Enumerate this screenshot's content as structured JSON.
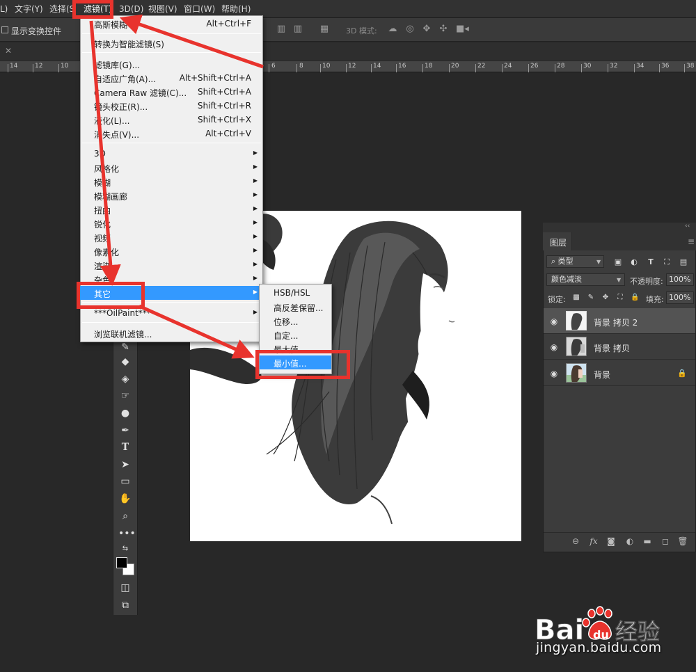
{
  "menubar": {
    "items": [
      "L)",
      "文字(Y)",
      "选择(S",
      "滤镜(T)",
      "3D(D)",
      "视图(V)",
      "窗口(W)",
      "帮助(H)"
    ]
  },
  "options": {
    "show_transform_label": "显示变换控件",
    "mode_3d_label": "3D 模式:"
  },
  "ruler": {
    "labels": [
      "14",
      "12",
      "10",
      "6",
      "8",
      "10",
      "12",
      "14",
      "16",
      "18",
      "20",
      "22",
      "24",
      "26",
      "28",
      "30",
      "32",
      "34",
      "36",
      "38"
    ]
  },
  "filter_menu": {
    "items": [
      {
        "label": "高斯模糊",
        "shortcut": "Alt+Ctrl+F"
      },
      {
        "label": "转换为智能滤镜(S)",
        "shortcut": ""
      },
      {
        "label": "滤镜库(G)...",
        "shortcut": ""
      },
      {
        "label": "自适应广角(A)...",
        "shortcut": "Alt+Shift+Ctrl+A"
      },
      {
        "label": "Camera Raw 滤镜(C)...",
        "shortcut": "Shift+Ctrl+A"
      },
      {
        "label": "镜头校正(R)...",
        "shortcut": "Shift+Ctrl+R"
      },
      {
        "label": "液化(L)...",
        "shortcut": "Shift+Ctrl+X"
      },
      {
        "label": "消失点(V)...",
        "shortcut": "Alt+Ctrl+V"
      },
      {
        "label": "3D",
        "shortcut": ""
      },
      {
        "label": "风格化",
        "shortcut": ""
      },
      {
        "label": "模糊",
        "shortcut": ""
      },
      {
        "label": "模糊画廊",
        "shortcut": ""
      },
      {
        "label": "扭曲",
        "shortcut": ""
      },
      {
        "label": "锐化",
        "shortcut": ""
      },
      {
        "label": "视频",
        "shortcut": ""
      },
      {
        "label": "像素化",
        "shortcut": ""
      },
      {
        "label": "渲染",
        "shortcut": ""
      },
      {
        "label": "杂色",
        "shortcut": ""
      },
      {
        "label": "其它",
        "shortcut": ""
      },
      {
        "label": "***OilPaint***",
        "shortcut": ""
      },
      {
        "label": "浏览联机滤镜...",
        "shortcut": ""
      }
    ]
  },
  "submenu": {
    "items": [
      "HSB/HSL",
      "高反差保留...",
      "位移...",
      "自定...",
      "最大值...",
      "最小值..."
    ]
  },
  "layers_panel": {
    "tab_label": "图层",
    "filter_kind": "类型",
    "blend_mode": "颜色减淡",
    "opacity_label": "不透明度:",
    "opacity_value": "100%",
    "lock_label": "锁定:",
    "fill_label": "填充:",
    "fill_value": "100%",
    "layers": [
      {
        "name": "背景 拷贝 2",
        "selected": true,
        "locked": false
      },
      {
        "name": "背景 拷贝",
        "selected": false,
        "locked": false
      },
      {
        "name": "背景",
        "selected": false,
        "locked": true
      }
    ],
    "footer_fx_label": "fx"
  },
  "icons": {
    "eye": "eye-icon",
    "lock": "lock-icon",
    "submenu_arrow": "chevron-right-icon"
  },
  "colors": {
    "menu_highlight": "#3399ff",
    "annotation": "#e8332d",
    "workspace": "#282828"
  },
  "watermark": {
    "brand_latin": "Bai",
    "brand_latin_2": "du",
    "brand_cn": "经验",
    "url": "jingyan.baidu.com"
  }
}
